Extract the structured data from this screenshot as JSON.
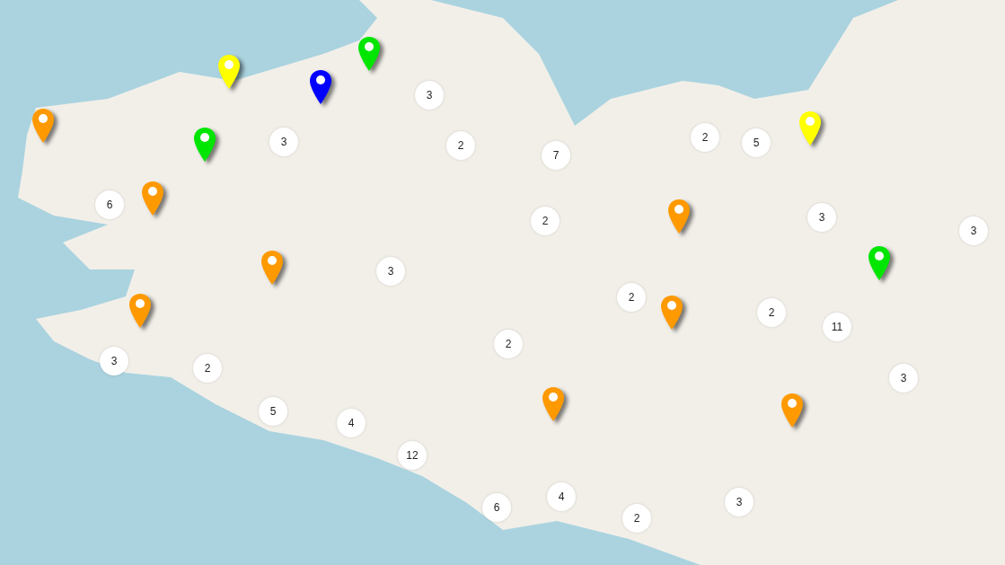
{
  "map": {
    "markers": [
      {
        "kind": "pin",
        "color": "#ffff00"
      },
      {
        "kind": "pin",
        "color": "#0000ff"
      },
      {
        "kind": "pin",
        "color": "#00e600"
      },
      {
        "kind": "cluster",
        "count": "3"
      },
      {
        "kind": "pin",
        "color": "#ff9900"
      },
      {
        "kind": "pin",
        "color": "#00e600"
      },
      {
        "kind": "cluster",
        "count": "3"
      },
      {
        "kind": "cluster",
        "count": "2"
      },
      {
        "kind": "cluster",
        "count": "7"
      },
      {
        "kind": "cluster",
        "count": "2"
      },
      {
        "kind": "cluster",
        "count": "5"
      },
      {
        "kind": "pin",
        "color": "#ffff00"
      },
      {
        "kind": "cluster",
        "count": "6"
      },
      {
        "kind": "pin",
        "color": "#ff9900"
      },
      {
        "kind": "cluster",
        "count": "2"
      },
      {
        "kind": "pin",
        "color": "#ff9900"
      },
      {
        "kind": "cluster",
        "count": "3"
      },
      {
        "kind": "cluster",
        "count": "3"
      },
      {
        "kind": "pin",
        "color": "#ff9900"
      },
      {
        "kind": "cluster",
        "count": "3"
      },
      {
        "kind": "pin",
        "color": "#00e600"
      },
      {
        "kind": "pin",
        "color": "#ff9900"
      },
      {
        "kind": "cluster",
        "count": "2"
      },
      {
        "kind": "pin",
        "color": "#ff9900"
      },
      {
        "kind": "cluster",
        "count": "2"
      },
      {
        "kind": "cluster",
        "count": "2"
      },
      {
        "kind": "cluster",
        "count": "11"
      },
      {
        "kind": "cluster",
        "count": "3"
      },
      {
        "kind": "cluster",
        "count": "2"
      },
      {
        "kind": "cluster",
        "count": "3"
      },
      {
        "kind": "cluster",
        "count": "5"
      },
      {
        "kind": "cluster",
        "count": "4"
      },
      {
        "kind": "pin",
        "color": "#ff9900"
      },
      {
        "kind": "pin",
        "color": "#ff9900"
      },
      {
        "kind": "cluster",
        "count": "12"
      },
      {
        "kind": "cluster",
        "count": "6"
      },
      {
        "kind": "cluster",
        "count": "4"
      },
      {
        "kind": "cluster",
        "count": "2"
      },
      {
        "kind": "cluster",
        "count": "3"
      }
    ]
  }
}
